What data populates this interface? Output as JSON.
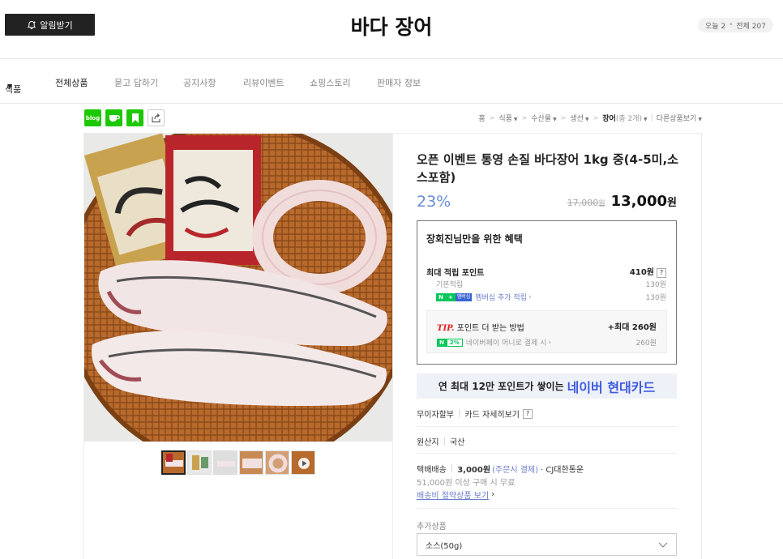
{
  "header": {
    "alarm_label": "알림받기",
    "store_name": "바다 장어",
    "visits": {
      "today": "오늘 2",
      "total": "전체 207"
    }
  },
  "nav": {
    "items": [
      "식품",
      "전체상품",
      "묻고 답하기",
      "공지사항",
      "리뷰이벤트",
      "쇼핑스토리",
      "판매자 정보"
    ]
  },
  "sns": {
    "blog_label": "blog"
  },
  "breadcrumb": {
    "home": "홈",
    "c1": "식품",
    "c2": "수산물",
    "c3": "생선",
    "current": "장어",
    "count": "(총 2개)",
    "more": "다른상품보기"
  },
  "product": {
    "name": "오픈 이벤트 통영 손질 바다장어 1kg 중(4-5미,소스포함)",
    "discount": "23%",
    "original_price": "17,000",
    "original_unit": "원",
    "sale_price": "13,000",
    "sale_unit": "원"
  },
  "benefit": {
    "title": "장회진님만을 위한 혜택",
    "max_point_label": "최대 적립 포인트",
    "max_point_value": "410원",
    "base_label": "기본적립",
    "base_value": "130원",
    "membership_link": "멤버십 추가 적립",
    "membership_value": "130원",
    "npay_badge": "N",
    "membership_badge": "멤버십",
    "tip_prefix": "TIP.",
    "tip_text": "포인트 더 받는 방법",
    "tip_max": "+최대 260원",
    "pay_badge_pct": "2%",
    "pay_text": "네이버페이 머니로 결제 시",
    "pay_value": "260원"
  },
  "card_banner": {
    "text": "연 최대 12만 포인트가 쌓이는",
    "highlight": "네이버 현대카드"
  },
  "installment": {
    "label": "무이자할부",
    "detail": "카드 자세히보기"
  },
  "origin": {
    "label": "원산지",
    "value": "국산"
  },
  "shipping": {
    "label": "택배배송",
    "fee": "3,000원",
    "paytype": "(주문시 결제)",
    "courier": "· CJ대한통운",
    "free_note": "51,000원 이상 구매 시 무료",
    "bundle_link": "배송비 절약상품 보기"
  },
  "addon": {
    "label": "추가상품",
    "selected": "소스(50g)"
  },
  "colors": {
    "accent_blue": "#3d5be0",
    "naver_green": "#1ec800"
  }
}
